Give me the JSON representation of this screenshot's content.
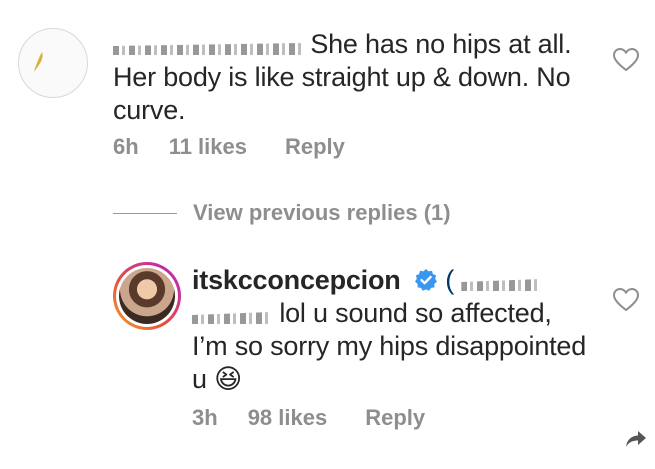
{
  "comment": {
    "text": "She has no hips at all. Her body is like straight up & down. No curve.",
    "time": "6h",
    "likes": "11 likes",
    "reply_label": "Reply"
  },
  "view_previous_replies": "View previous replies (1)",
  "reply": {
    "username": "itskcconcepcion",
    "mention_start": "(",
    "text": "lol u sound so affected, I’m so sorry my hips disappointed u 😆",
    "time": "3h",
    "likes": "98 likes",
    "reply_label": "Reply"
  },
  "icons": {
    "heart": "heart-outline-icon",
    "verified": "verified-badge-icon",
    "share": "share-arrow-icon"
  }
}
